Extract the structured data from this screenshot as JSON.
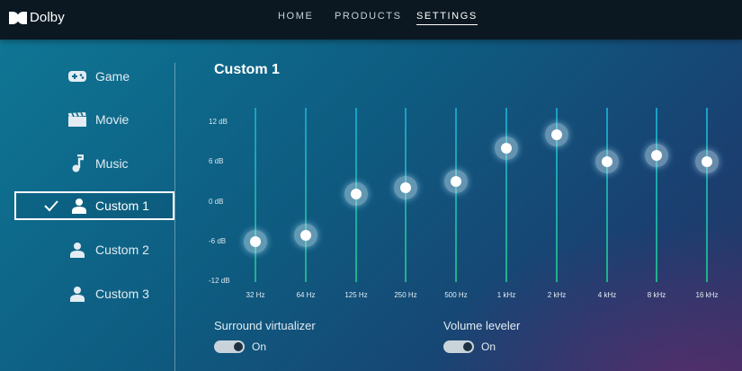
{
  "app": {
    "brand": "Dolby"
  },
  "nav": [
    {
      "label": "HOME",
      "active": false
    },
    {
      "label": "PRODUCTS",
      "active": false
    },
    {
      "label": "SETTINGS",
      "active": true
    }
  ],
  "sidebar": {
    "items": [
      {
        "label": "Game",
        "icon": "gamepad-icon",
        "selected": false
      },
      {
        "label": "Movie",
        "icon": "clapperboard-icon",
        "selected": false
      },
      {
        "label": "Music",
        "icon": "music-note-icon",
        "selected": false
      },
      {
        "label": "Custom 1",
        "icon": "user-icon",
        "selected": true
      },
      {
        "label": "Custom 2",
        "icon": "user-icon",
        "selected": false
      },
      {
        "label": "Custom 3",
        "icon": "user-icon",
        "selected": false
      }
    ]
  },
  "equalizer": {
    "title": "Custom 1",
    "db_ticks": [
      "12 dB",
      "6 dB",
      "0 dB",
      "-6 dB",
      "-12 dB"
    ],
    "range_db": [
      -12,
      12
    ],
    "bands": [
      {
        "freq": "32 Hz",
        "gain_db": -6.2
      },
      {
        "freq": "64 Hz",
        "gain_db": -5.2
      },
      {
        "freq": "125 Hz",
        "gain_db": 1.0
      },
      {
        "freq": "250 Hz",
        "gain_db": 1.9
      },
      {
        "freq": "500 Hz",
        "gain_db": 2.9
      },
      {
        "freq": "1 kHz",
        "gain_db": 7.9
      },
      {
        "freq": "2 kHz",
        "gain_db": 9.9
      },
      {
        "freq": "4 kHz",
        "gain_db": 5.9
      },
      {
        "freq": "8 kHz",
        "gain_db": 6.9
      },
      {
        "freq": "16 kHz",
        "gain_db": 5.9
      }
    ]
  },
  "options": {
    "surround": {
      "label": "Surround virtualizer",
      "state": "On"
    },
    "volume": {
      "label": "Volume leveler",
      "state": "On"
    }
  },
  "colors": {
    "accent": "#1fb28a",
    "topbar": "#0b1822"
  }
}
